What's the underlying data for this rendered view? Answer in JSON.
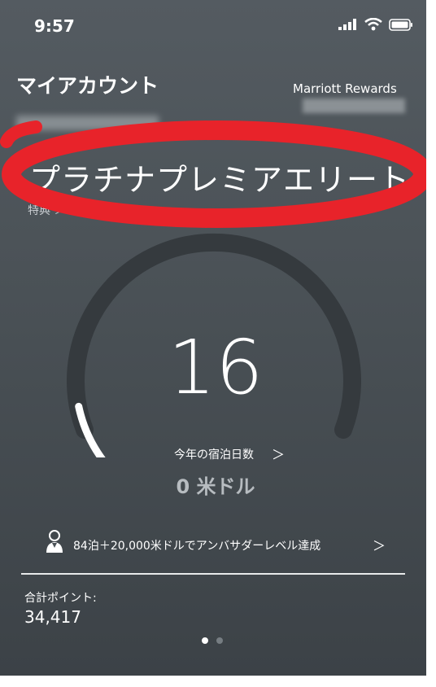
{
  "status_bar": {
    "time": "9:57"
  },
  "header": {
    "title": "マイアカウント",
    "brand": "Marriott Rewards"
  },
  "membership": {
    "tier": "プラチナプレミアエリート",
    "benefits_link": "特典 ＞",
    "highlight_color": "#e8232a"
  },
  "stats": {
    "nights_value": "16",
    "nights_label": "今年の宿泊日数",
    "nights_chevron": "＞",
    "spend": "0 米ドル",
    "nights_progress_fraction": 0.16
  },
  "goal": {
    "text": "84泊＋20,000米ドルでアンバサダーレベル達成",
    "chevron": "＞",
    "icon": "ambassador-person-icon"
  },
  "points": {
    "label": "合計ポイント:",
    "value": "34,417"
  },
  "pager": {
    "page_count": 2,
    "active_index": 0
  }
}
